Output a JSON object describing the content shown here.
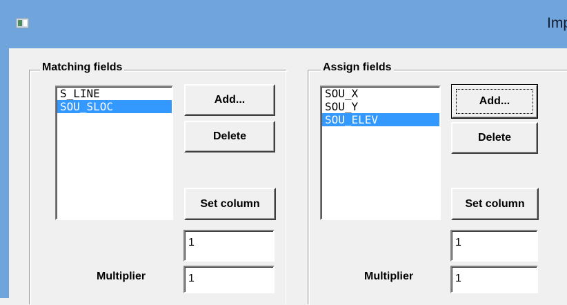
{
  "window": {
    "title": "Imp"
  },
  "matching": {
    "legend": "Matching fields",
    "items": [
      "S_LINE",
      "SOU_SLOC"
    ],
    "selected": 1,
    "add_label": "Add...",
    "delete_label": "Delete",
    "set_column_label": "Set column",
    "column_value": "1",
    "multiplier_label": "Multiplier",
    "multiplier_value": "1"
  },
  "assign": {
    "legend": "Assign fields",
    "items": [
      "SOU_X",
      "SOU_Y",
      "SOU_ELEV"
    ],
    "selected": 2,
    "add_label": "Add...",
    "delete_label": "Delete",
    "set_column_label": "Set column",
    "column_value": "1",
    "multiplier_label": "Multiplier",
    "multiplier_value": "1"
  },
  "colors": {
    "titlebar": "#70a4dc",
    "selection": "#3399ff",
    "dialog_bg": "#f0f0f0"
  }
}
